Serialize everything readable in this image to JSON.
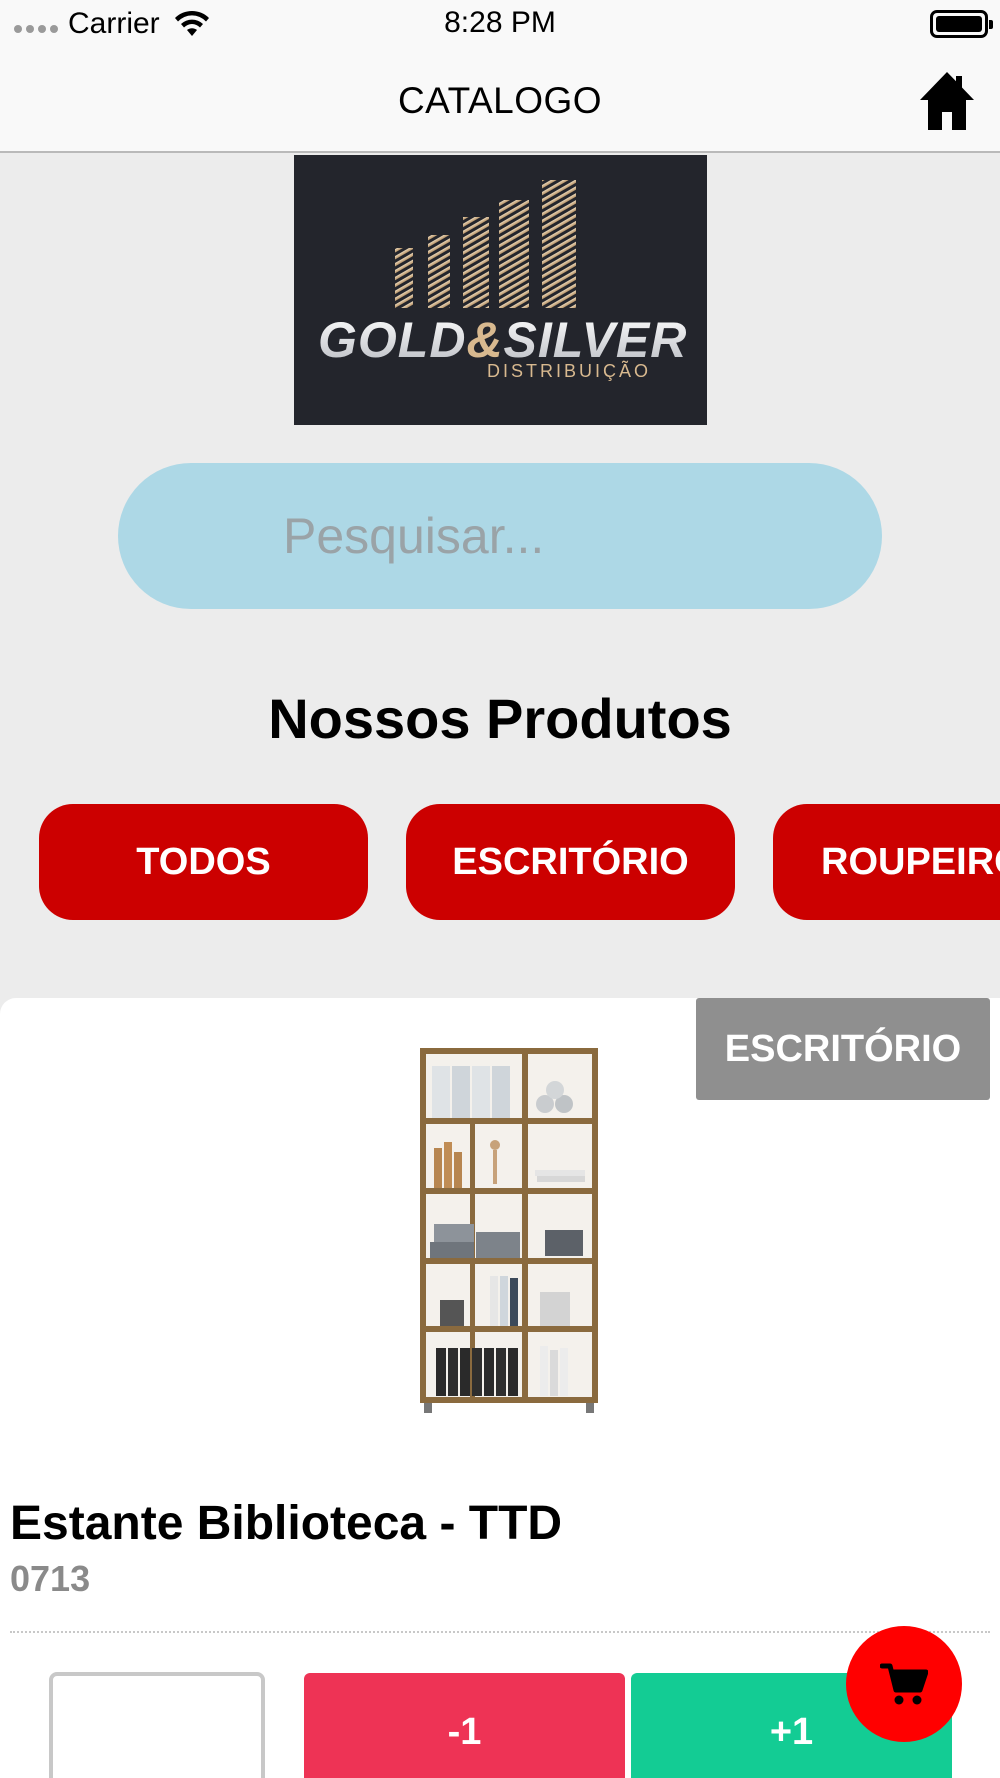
{
  "status_bar": {
    "carrier": "Carrier",
    "time": "8:28 PM"
  },
  "nav": {
    "title": "CATALOGO",
    "home_icon": "home-icon"
  },
  "logo": {
    "brand_text": "GOLD&SILVER",
    "subtitle": "DISTRIBUIÇÃO"
  },
  "search": {
    "placeholder": "Pesquisar...",
    "value": ""
  },
  "section_title": "Nossos Produtos",
  "categories": [
    {
      "label": "TODOS"
    },
    {
      "label": "ESCRITÓRIO"
    },
    {
      "label": "ROUPEIRO"
    }
  ],
  "product": {
    "category_badge": "ESCRITÓRIO",
    "name": "Estante Biblioteca - TTD",
    "code": "0713",
    "quantity": "",
    "decrement_label": "-1",
    "increment_label": "+1"
  },
  "cart_icon": "cart-icon",
  "colors": {
    "category_red": "#cc0000",
    "search_bg": "#add8e6",
    "minus_red": "#ee3355",
    "plus_green": "#13cc94",
    "cart_red": "#ff0000",
    "badge_gray": "#8f8f8f"
  }
}
